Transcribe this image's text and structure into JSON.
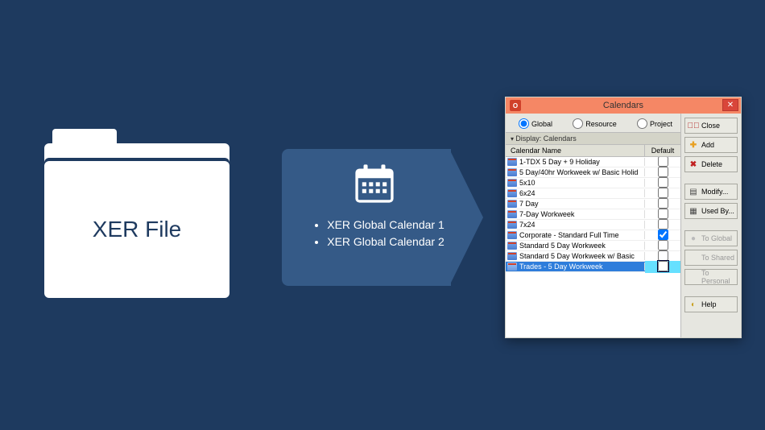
{
  "folder": {
    "label": "XER File"
  },
  "arrow": {
    "items": [
      "XER Global Calendar 1",
      "XER Global Calendar 2"
    ]
  },
  "dialog": {
    "title": "Calendars",
    "scope": {
      "options": [
        "Global",
        "Resource",
        "Project"
      ],
      "selected": "Global"
    },
    "display_label": "Display: Calendars",
    "columns": {
      "name": "Calendar Name",
      "default": "Default"
    },
    "rows": [
      {
        "name": "1-TDX 5 Day + 9 Holiday",
        "default": false,
        "selected": false
      },
      {
        "name": "5 Day/40hr Workweek w/ Basic Holid",
        "default": false,
        "selected": false
      },
      {
        "name": "5x10",
        "default": false,
        "selected": false
      },
      {
        "name": "6x24",
        "default": false,
        "selected": false
      },
      {
        "name": "7 Day",
        "default": false,
        "selected": false
      },
      {
        "name": "7-Day Workweek",
        "default": false,
        "selected": false
      },
      {
        "name": "7x24",
        "default": false,
        "selected": false
      },
      {
        "name": "Corporate - Standard Full Time",
        "default": true,
        "selected": false
      },
      {
        "name": "Standard 5 Day Workweek",
        "default": false,
        "selected": false
      },
      {
        "name": "Standard 5 Day Workweek w/ Basic",
        "default": false,
        "selected": false
      },
      {
        "name": "Trades - 5 Day Workweek",
        "default": false,
        "selected": true
      }
    ],
    "buttons": {
      "close": "Close",
      "add": "Add",
      "delete": "Delete",
      "modify": "Modify...",
      "used_by": "Used By...",
      "to_global": "To Global",
      "to_shared": "To Shared",
      "to_personal": "To Personal",
      "help": "Help"
    }
  }
}
